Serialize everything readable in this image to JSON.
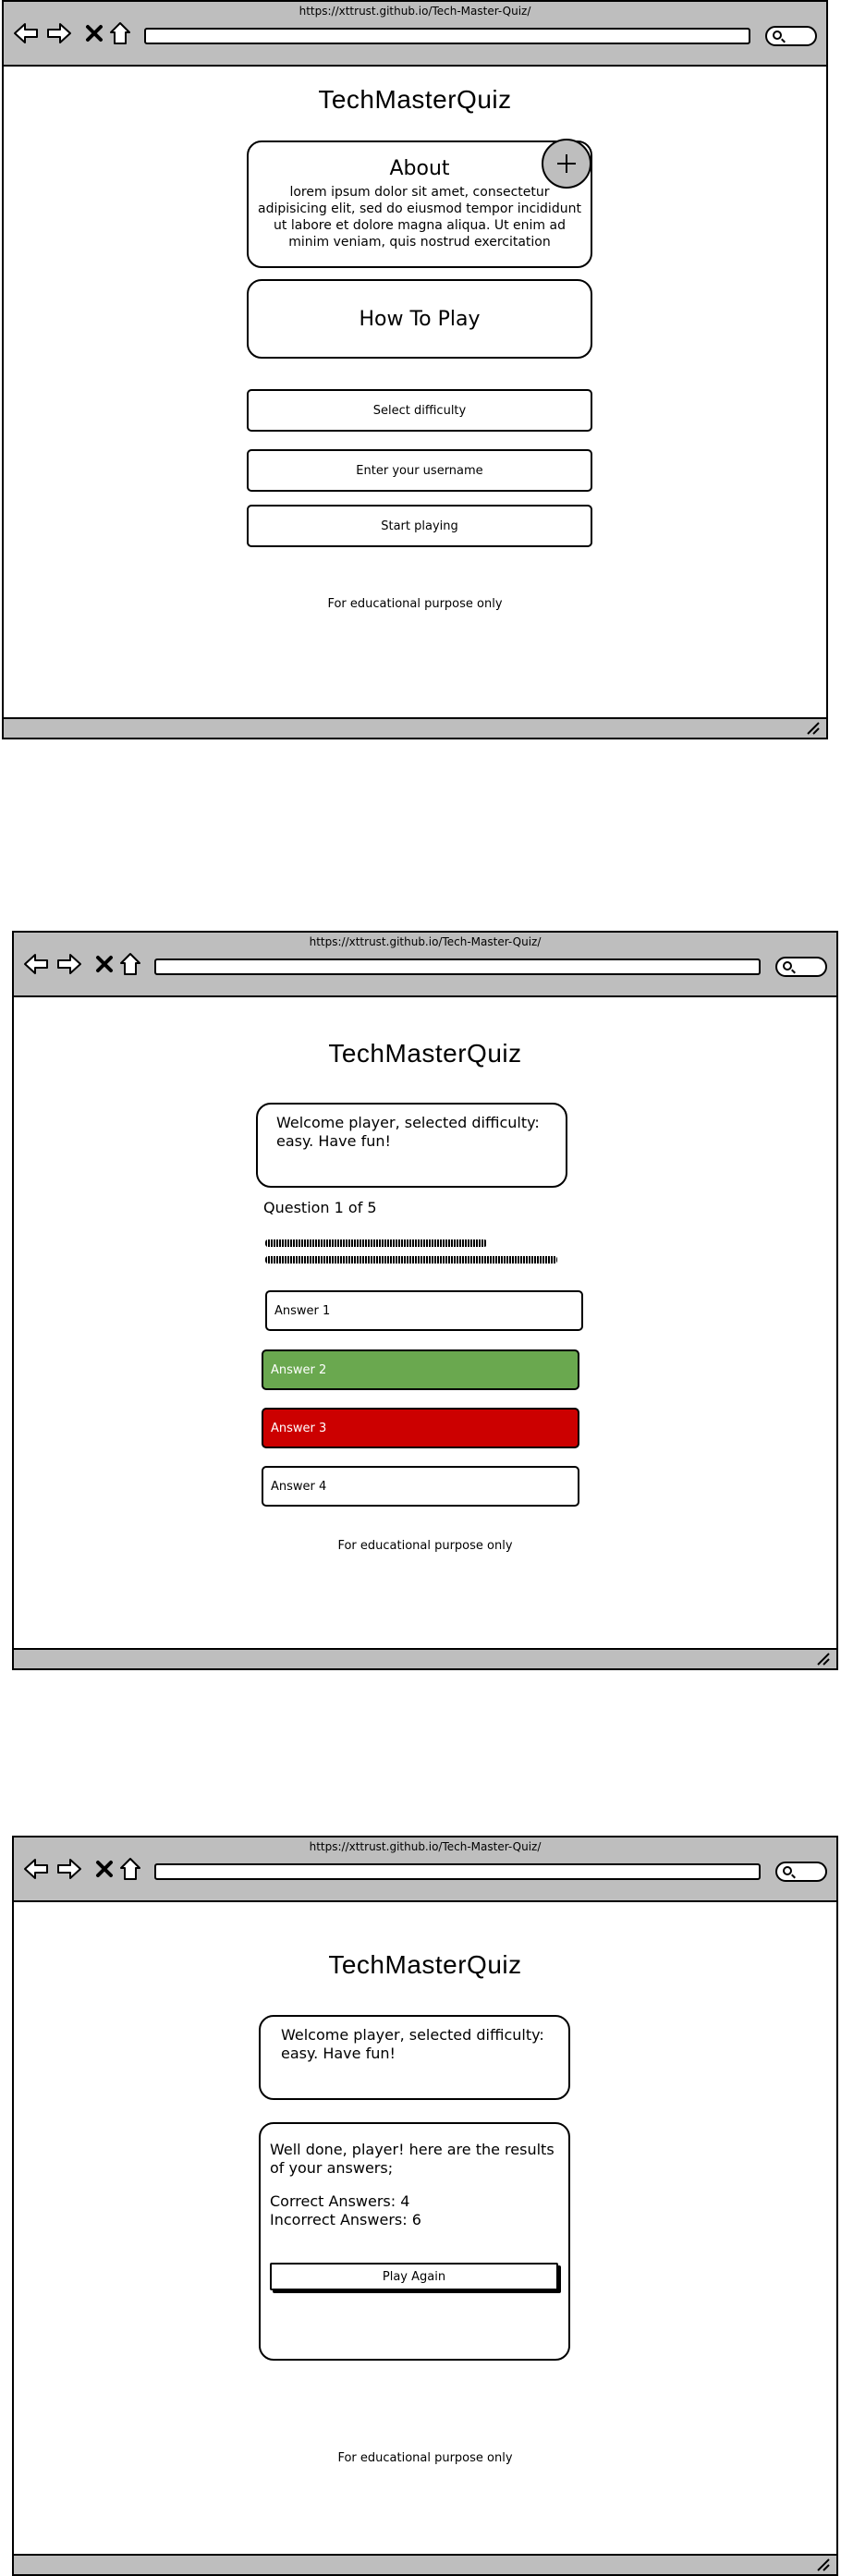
{
  "app": {
    "url": "https://xttrust.github.io/Tech-Master-Quiz/",
    "title": "TechMasterQuiz",
    "footer": "For educational purpose only"
  },
  "screen1": {
    "about_title": "About",
    "about_text": "lorem ipsum dolor sit amet, consectetur adipisicing elit, sed do eiusmod tempor incididunt ut labore et dolore magna aliqua. Ut enim ad minim veniam, quis nostrud exercitation",
    "how_to_play": "How To Play",
    "select_difficulty": "Select difficulty",
    "username_placeholder": "Enter your username",
    "start_playing": "Start playing"
  },
  "screen2": {
    "welcome": "Welcome player, selected difficulty: easy. Have fun!",
    "question_counter": "Question 1 of 5",
    "answers": [
      {
        "label": "Answer 1",
        "state": "default"
      },
      {
        "label": "Answer 2",
        "state": "correct"
      },
      {
        "label": "Answer 3",
        "state": "wrong"
      },
      {
        "label": "Answer 4",
        "state": "default"
      }
    ]
  },
  "screen3": {
    "welcome": "Welcome player, selected difficulty: easy. Have fun!",
    "results_intro": "Well done, player! here are the results of your answers;",
    "correct_answers": "Correct Answers: 4",
    "incorrect_answers": "Incorrect Answers: 6",
    "play_again": "Play Again"
  },
  "colors": {
    "chrome": "#bebebe",
    "correct": "#6aa84f",
    "wrong": "#cc0000"
  },
  "icons": [
    "back-arrow-icon",
    "forward-arrow-icon",
    "close-icon",
    "home-icon",
    "search-icon",
    "plus-icon",
    "resize-grip-icon"
  ]
}
